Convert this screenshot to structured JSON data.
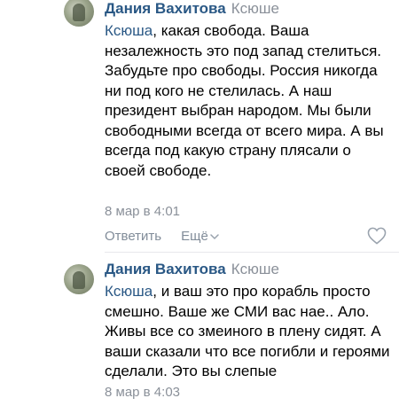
{
  "comments": [
    {
      "author": "Дания Вахитова",
      "reply_to": "Ксюше",
      "mention": "Ксюша",
      "text": ", какая свобода. Ваша незалежность это под запад стелиться. Забудьте про свободы. Россия никогда ни под кого не стелилась. А наш президент выбран народом. Мы были свободными всегда от всего мира. А вы всегда под какую страну плясали о своей свободе.",
      "time": "8 мар в 4:01",
      "actions": {
        "reply": "Ответить",
        "more": "Ещё"
      }
    },
    {
      "author": "Дания Вахитова",
      "reply_to": "Ксюше",
      "mention": "Ксюша",
      "text": ", и ваш это про корабль просто смешно. Ваше же СМИ вас нае.. Ало. Живы все со змеиного в плену сидят. А ваши сказали что все погибли и героями сделали. Это вы слепые",
      "time": "8 мар в 4:03"
    }
  ],
  "colors": {
    "link": "#2a5885",
    "muted": "#8a9099",
    "divider": "#e7e8ec"
  },
  "icons": [
    "heart-outline-icon",
    "chevron-down-icon",
    "avatar-photo"
  ]
}
